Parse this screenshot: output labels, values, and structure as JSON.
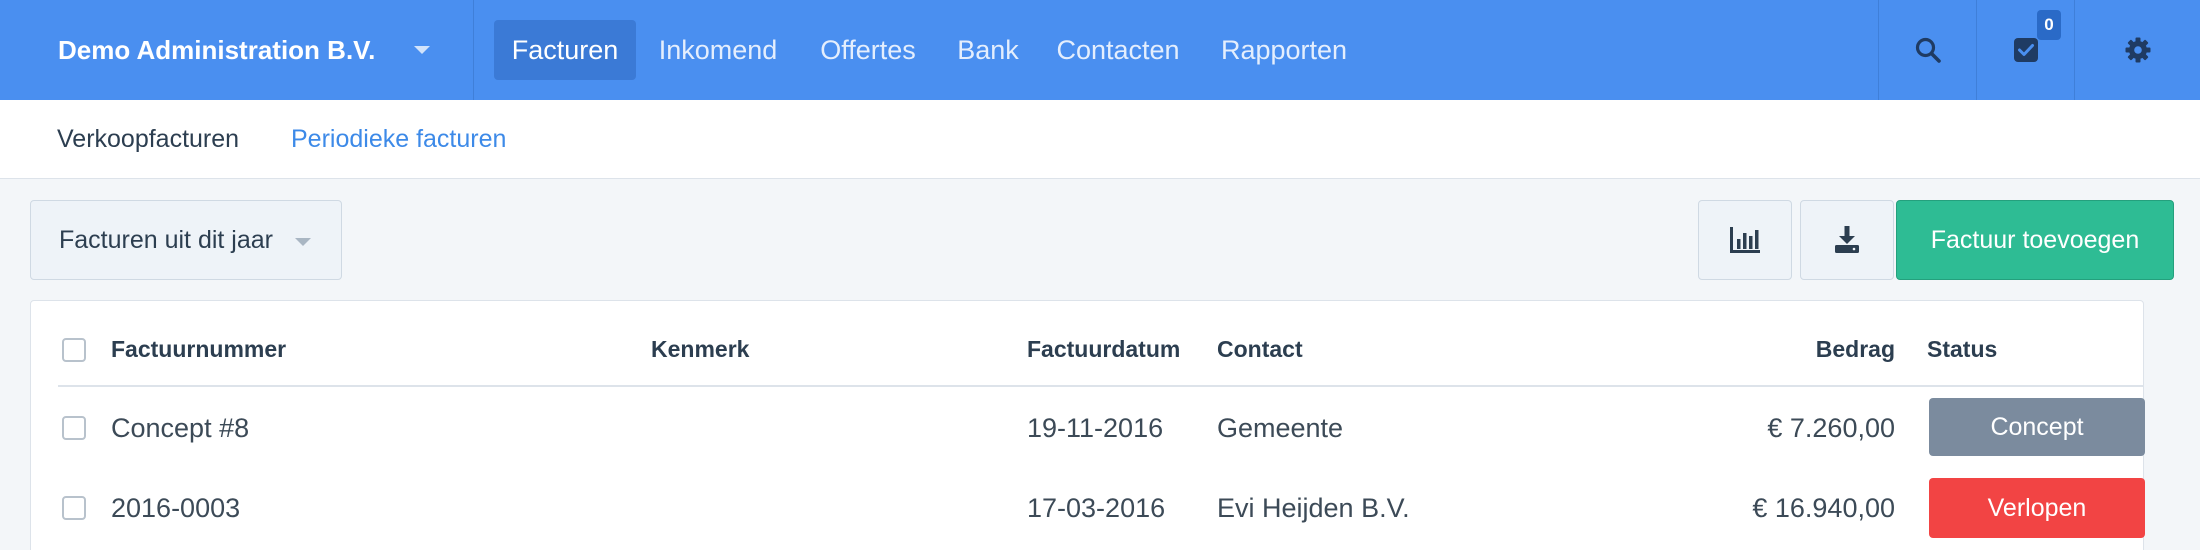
{
  "header": {
    "company": "Demo Administration B.V.",
    "nav": [
      {
        "label": "Facturen"
      },
      {
        "label": "Inkomend"
      },
      {
        "label": "Offertes"
      },
      {
        "label": "Bank"
      },
      {
        "label": "Contacten"
      },
      {
        "label": "Rapporten"
      }
    ],
    "active_nav": "Facturen",
    "icons": [
      "search-icon",
      "task-check-icon",
      "gear-icon"
    ],
    "tasks_badge": "0"
  },
  "subnav": {
    "items": [
      {
        "label": "Verkoopfacturen"
      },
      {
        "label": "Periodieke facturen"
      }
    ]
  },
  "toolbar": {
    "filter_label": "Facturen uit dit jaar",
    "chart_icon": "bar-chart-icon",
    "download_icon": "download-icon",
    "add_label": "Factuur toevoegen"
  },
  "table": {
    "columns": {
      "number": "Factuurnummer",
      "reference": "Kenmerk",
      "date": "Factuurdatum",
      "contact": "Contact",
      "amount": "Bedrag",
      "status": "Status"
    },
    "rows": [
      {
        "number": "Concept #8",
        "reference": "",
        "date": "19-11-2016",
        "contact": "Gemeente",
        "amount": "€ 7.260,00",
        "status": "Concept"
      },
      {
        "number": "2016-0003",
        "reference": "",
        "date": "17-03-2016",
        "contact": "Evi Heijden B.V.",
        "amount": "€ 16.940,00",
        "status": "Verlopen"
      }
    ]
  },
  "colors": {
    "topbar": "#4a8ff0",
    "accent_green": "#2ebc94",
    "status_concept": "#7b8b9e",
    "status_overdue": "#f24444",
    "link": "#3d8ae8"
  }
}
